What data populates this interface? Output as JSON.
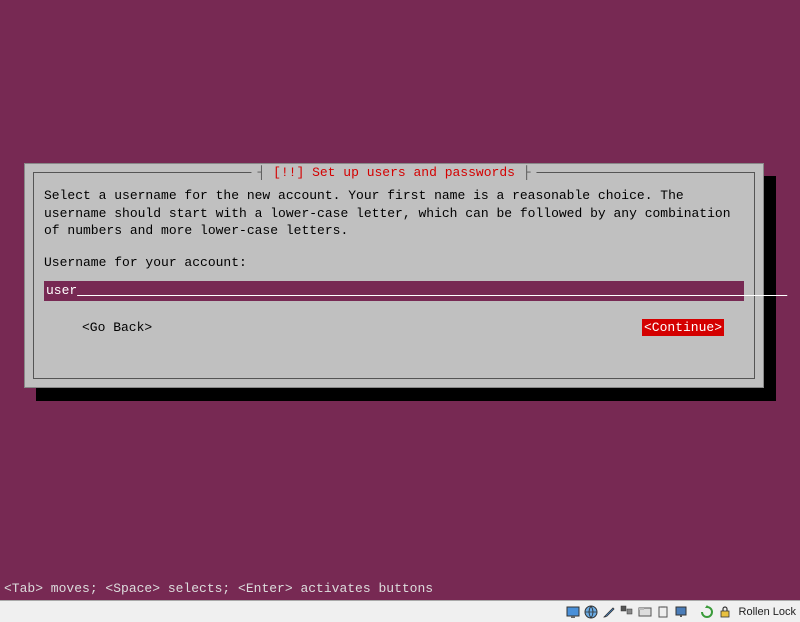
{
  "dialog": {
    "title": "[!!] Set up users and passwords",
    "description": "Select a username for the new account. Your first name is a reasonable choice. The\nusername should start with a lower-case letter, which can be followed by any combination\nof numbers and more lower-case letters.",
    "prompt": "Username for your account:",
    "input_value": "user",
    "go_back_label": "<Go Back>",
    "continue_label": "<Continue>"
  },
  "help_text": "<Tab> moves; <Space> selects; <Enter> activates buttons",
  "taskbar": {
    "lock_label": "Rollen Lock"
  }
}
